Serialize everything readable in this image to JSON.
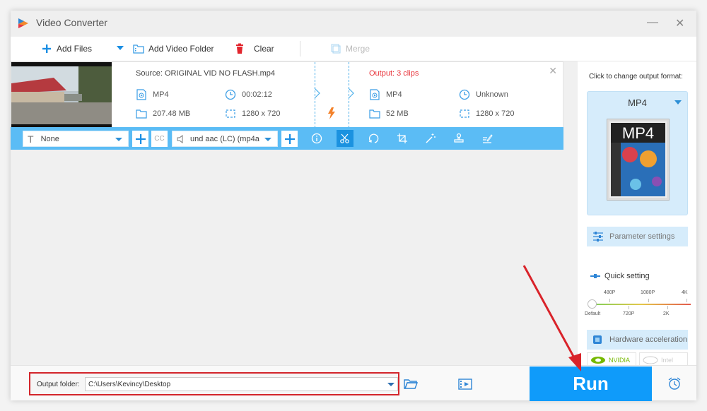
{
  "window": {
    "title": "Video Converter",
    "minimize_label": "—",
    "close_label": "✕"
  },
  "toolbar": {
    "add_files": "Add Files",
    "add_video_folder": "Add Video Folder",
    "clear": "Clear",
    "merge": "Merge"
  },
  "file": {
    "source_title": "Source: ORIGINAL VID NO FLASH.mp4",
    "output_title": "Output: 3 clips",
    "source": {
      "format": "MP4",
      "duration": "00:02:12",
      "size": "207.48 MB",
      "resolution": "1280 x 720"
    },
    "output": {
      "format": "MP4",
      "duration": "Unknown",
      "size": "52 MB",
      "resolution": "1280 x 720"
    },
    "remove_label": "✕"
  },
  "edit_bar": {
    "subtitle_value": "None",
    "audio_value": "und aac (LC) (mp4a",
    "tools": [
      "info-icon",
      "cut-icon",
      "rotate-icon",
      "crop-icon",
      "effects-icon",
      "watermark-icon",
      "edit-icon"
    ]
  },
  "right_panel": {
    "change_format_label": "Click to change output format:",
    "format": "MP4",
    "format_image_text": "MP4",
    "parameter_settings": "Parameter settings",
    "quick_setting": "Quick setting",
    "quick_setting_value": "Default",
    "ticks_top": [
      "480P",
      "1080P",
      "4K"
    ],
    "ticks_bottom": [
      "Default",
      "720P",
      "2K"
    ],
    "hardware_acceleration": "Hardware acceleration",
    "nvidia": "NVIDIA",
    "intel": "Intel"
  },
  "bottom": {
    "output_folder_label": "Output folder:",
    "output_folder_value": "C:\\Users\\Kevincy\\Desktop",
    "run_label": "Run"
  },
  "colors": {
    "accent": "#0f9bfa",
    "edit_bar": "#5bbcf5",
    "output_title": "#e8333a",
    "highlight_box": "#d3252b"
  }
}
